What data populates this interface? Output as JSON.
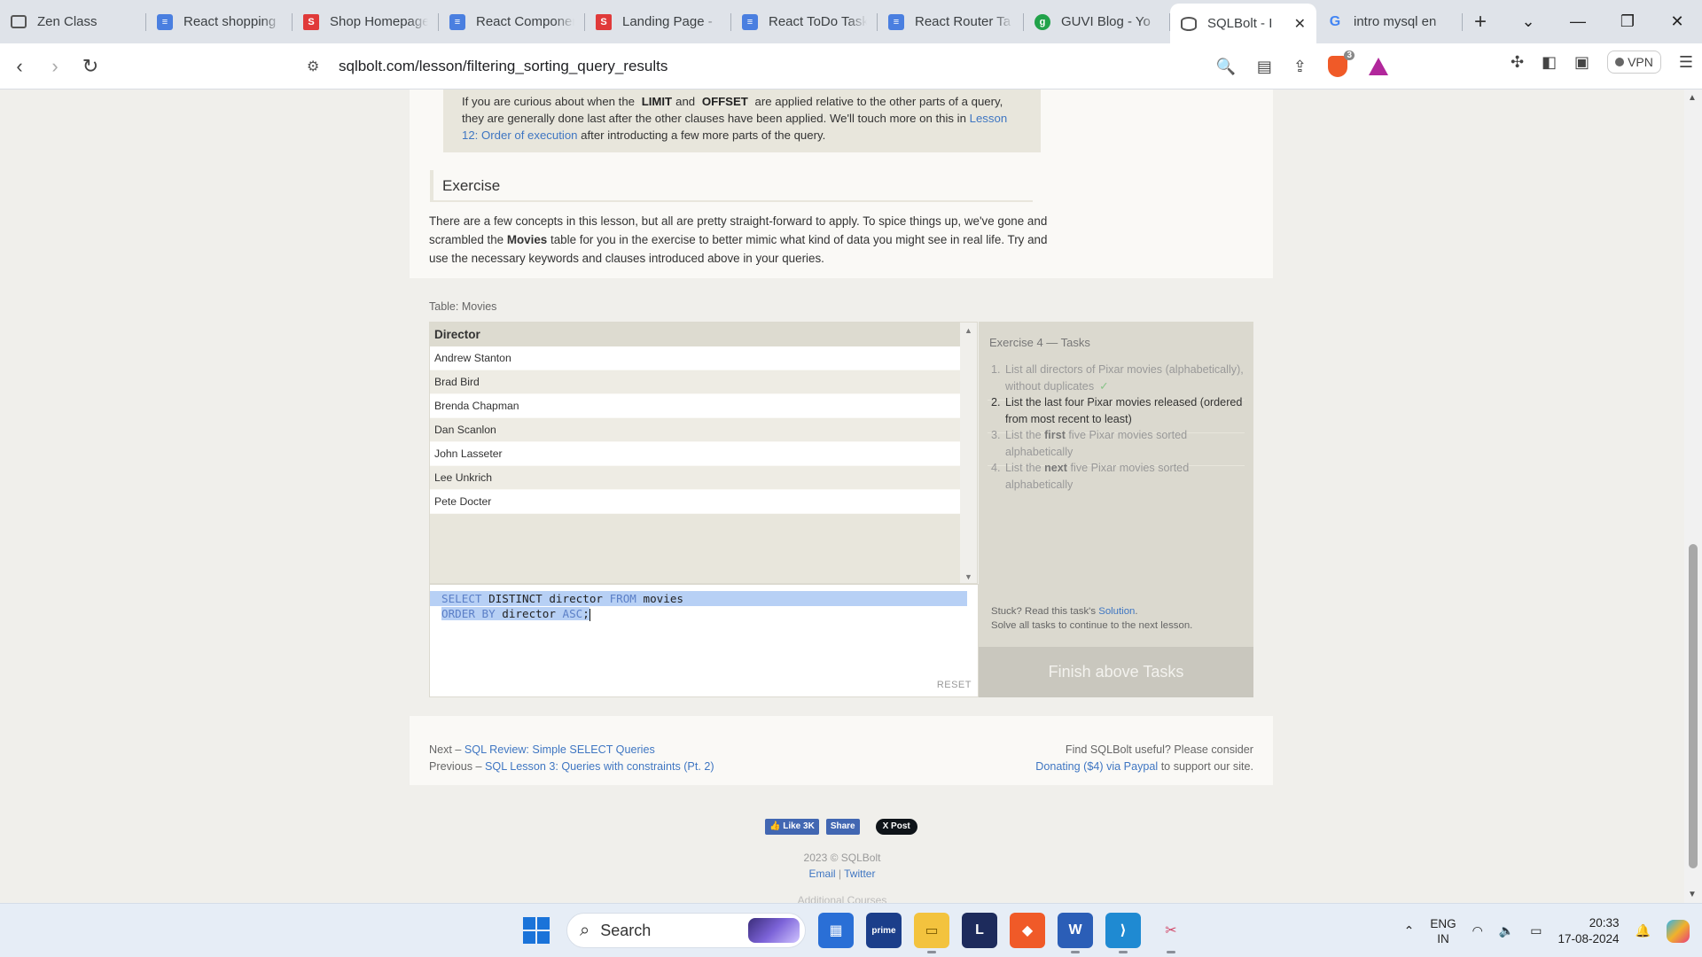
{
  "browser": {
    "tabs": [
      {
        "title": "Zen Class",
        "icon": "zen-class-icon",
        "active": false
      },
      {
        "title": "React shopping",
        "icon": "docs-icon",
        "active": false
      },
      {
        "title": "Shop Homepage",
        "icon": "s-icon",
        "active": false
      },
      {
        "title": "React Components",
        "icon": "docs-icon",
        "active": false
      },
      {
        "title": "Landing Page -",
        "icon": "s-icon",
        "active": false
      },
      {
        "title": "React ToDo Task",
        "icon": "docs-icon",
        "active": false
      },
      {
        "title": "React Router Ta",
        "icon": "docs-icon",
        "active": false
      },
      {
        "title": "GUVI Blog - Yo",
        "icon": "guvi-icon",
        "active": false
      },
      {
        "title": "SQLBolt - I",
        "icon": "sqlbolt-icon",
        "active": true
      },
      {
        "title": "intro mysql en",
        "icon": "google-icon",
        "active": false
      }
    ],
    "url": "sqlbolt.com/lesson/filtering_sorting_query_results",
    "brave_shield_count": "3",
    "vpn_label": "VPN"
  },
  "page": {
    "note": {
      "prefix": "If you are curious about when the",
      "kw1": "LIMIT",
      "mid": "and",
      "kw2": "OFFSET",
      "rest": "are applied relative to the other parts of a query, they are generally done last after the other clauses have been applied. We'll touch more on this in",
      "link": "Lesson 12: Order of execution",
      "suffix": "after introducting a few more parts of the query."
    },
    "exercise_heading": "Exercise",
    "exercise_intro": {
      "before": "There are a few concepts in this lesson, but all are pretty straight-forward to apply. To spice things up, we've gone and scrambled the",
      "bold": "Movies",
      "after": "table for you in the exercise to better mimic what kind of data you might see in real life. Try and use the necessary keywords and clauses introduced above in your queries."
    },
    "table_label": "Table: Movies",
    "results": {
      "columns": [
        "Director"
      ],
      "rows": [
        "Andrew Stanton",
        "Brad Bird",
        "Brenda Chapman",
        "Dan Scanlon",
        "John Lasseter",
        "Lee Unkrich",
        "Pete Docter"
      ]
    },
    "editor": {
      "line1": {
        "kw1": "SELECT",
        "t1": " DISTINCT director ",
        "kw2": "FROM",
        "t2": " movies"
      },
      "line2": {
        "kw1": "ORDER BY",
        "t1": " director ",
        "kw2": "ASC",
        "t2": ";"
      },
      "reset_label": "RESET"
    },
    "tasks": {
      "title": "Exercise 4 — Tasks",
      "items": [
        {
          "num": "1.",
          "text": "List all directors of Pixar movies (alphabetically), without duplicates",
          "done": true
        },
        {
          "num": "2.",
          "text": "List the last four Pixar movies released (ordered from most recent to least)",
          "done": false
        },
        {
          "num": "3.",
          "pre": "List the",
          "bold": "first",
          "post": "five Pixar movies sorted alphabetically",
          "done": false
        },
        {
          "num": "4.",
          "pre": "List the",
          "bold": "next",
          "post": "five Pixar movies sorted alphabetically",
          "done": false
        }
      ],
      "check_mark": "✓",
      "stuck_prefix": "Stuck? Read this task's",
      "stuck_link": "Solution",
      "stuck_suffix": ".",
      "solve_all": "Solve all tasks to continue to the next lesson.",
      "finish_label": "Finish above Tasks"
    },
    "pager": {
      "next_prefix": "Next –",
      "next_link": "SQL Review: Simple SELECT Queries",
      "prev_prefix": "Previous –",
      "prev_link": "SQL Lesson 3: Queries with constraints (Pt. 2)"
    },
    "support": {
      "line1": "Find SQLBolt useful? Please consider",
      "link": "Donating ($4) via Paypal",
      "suffix": "to support our site."
    },
    "social": {
      "like": "Like 3K",
      "share": "Share",
      "post": "X Post"
    },
    "footer": {
      "copyright": "2023 © SQLBolt",
      "email": "Email",
      "sep": "|",
      "twitter": "Twitter",
      "additional": "Additional Courses"
    }
  },
  "taskbar": {
    "search_label": "Search",
    "lang_line1": "ENG",
    "lang_line2": "IN",
    "time": "20:33",
    "date": "17-08-2024"
  }
}
